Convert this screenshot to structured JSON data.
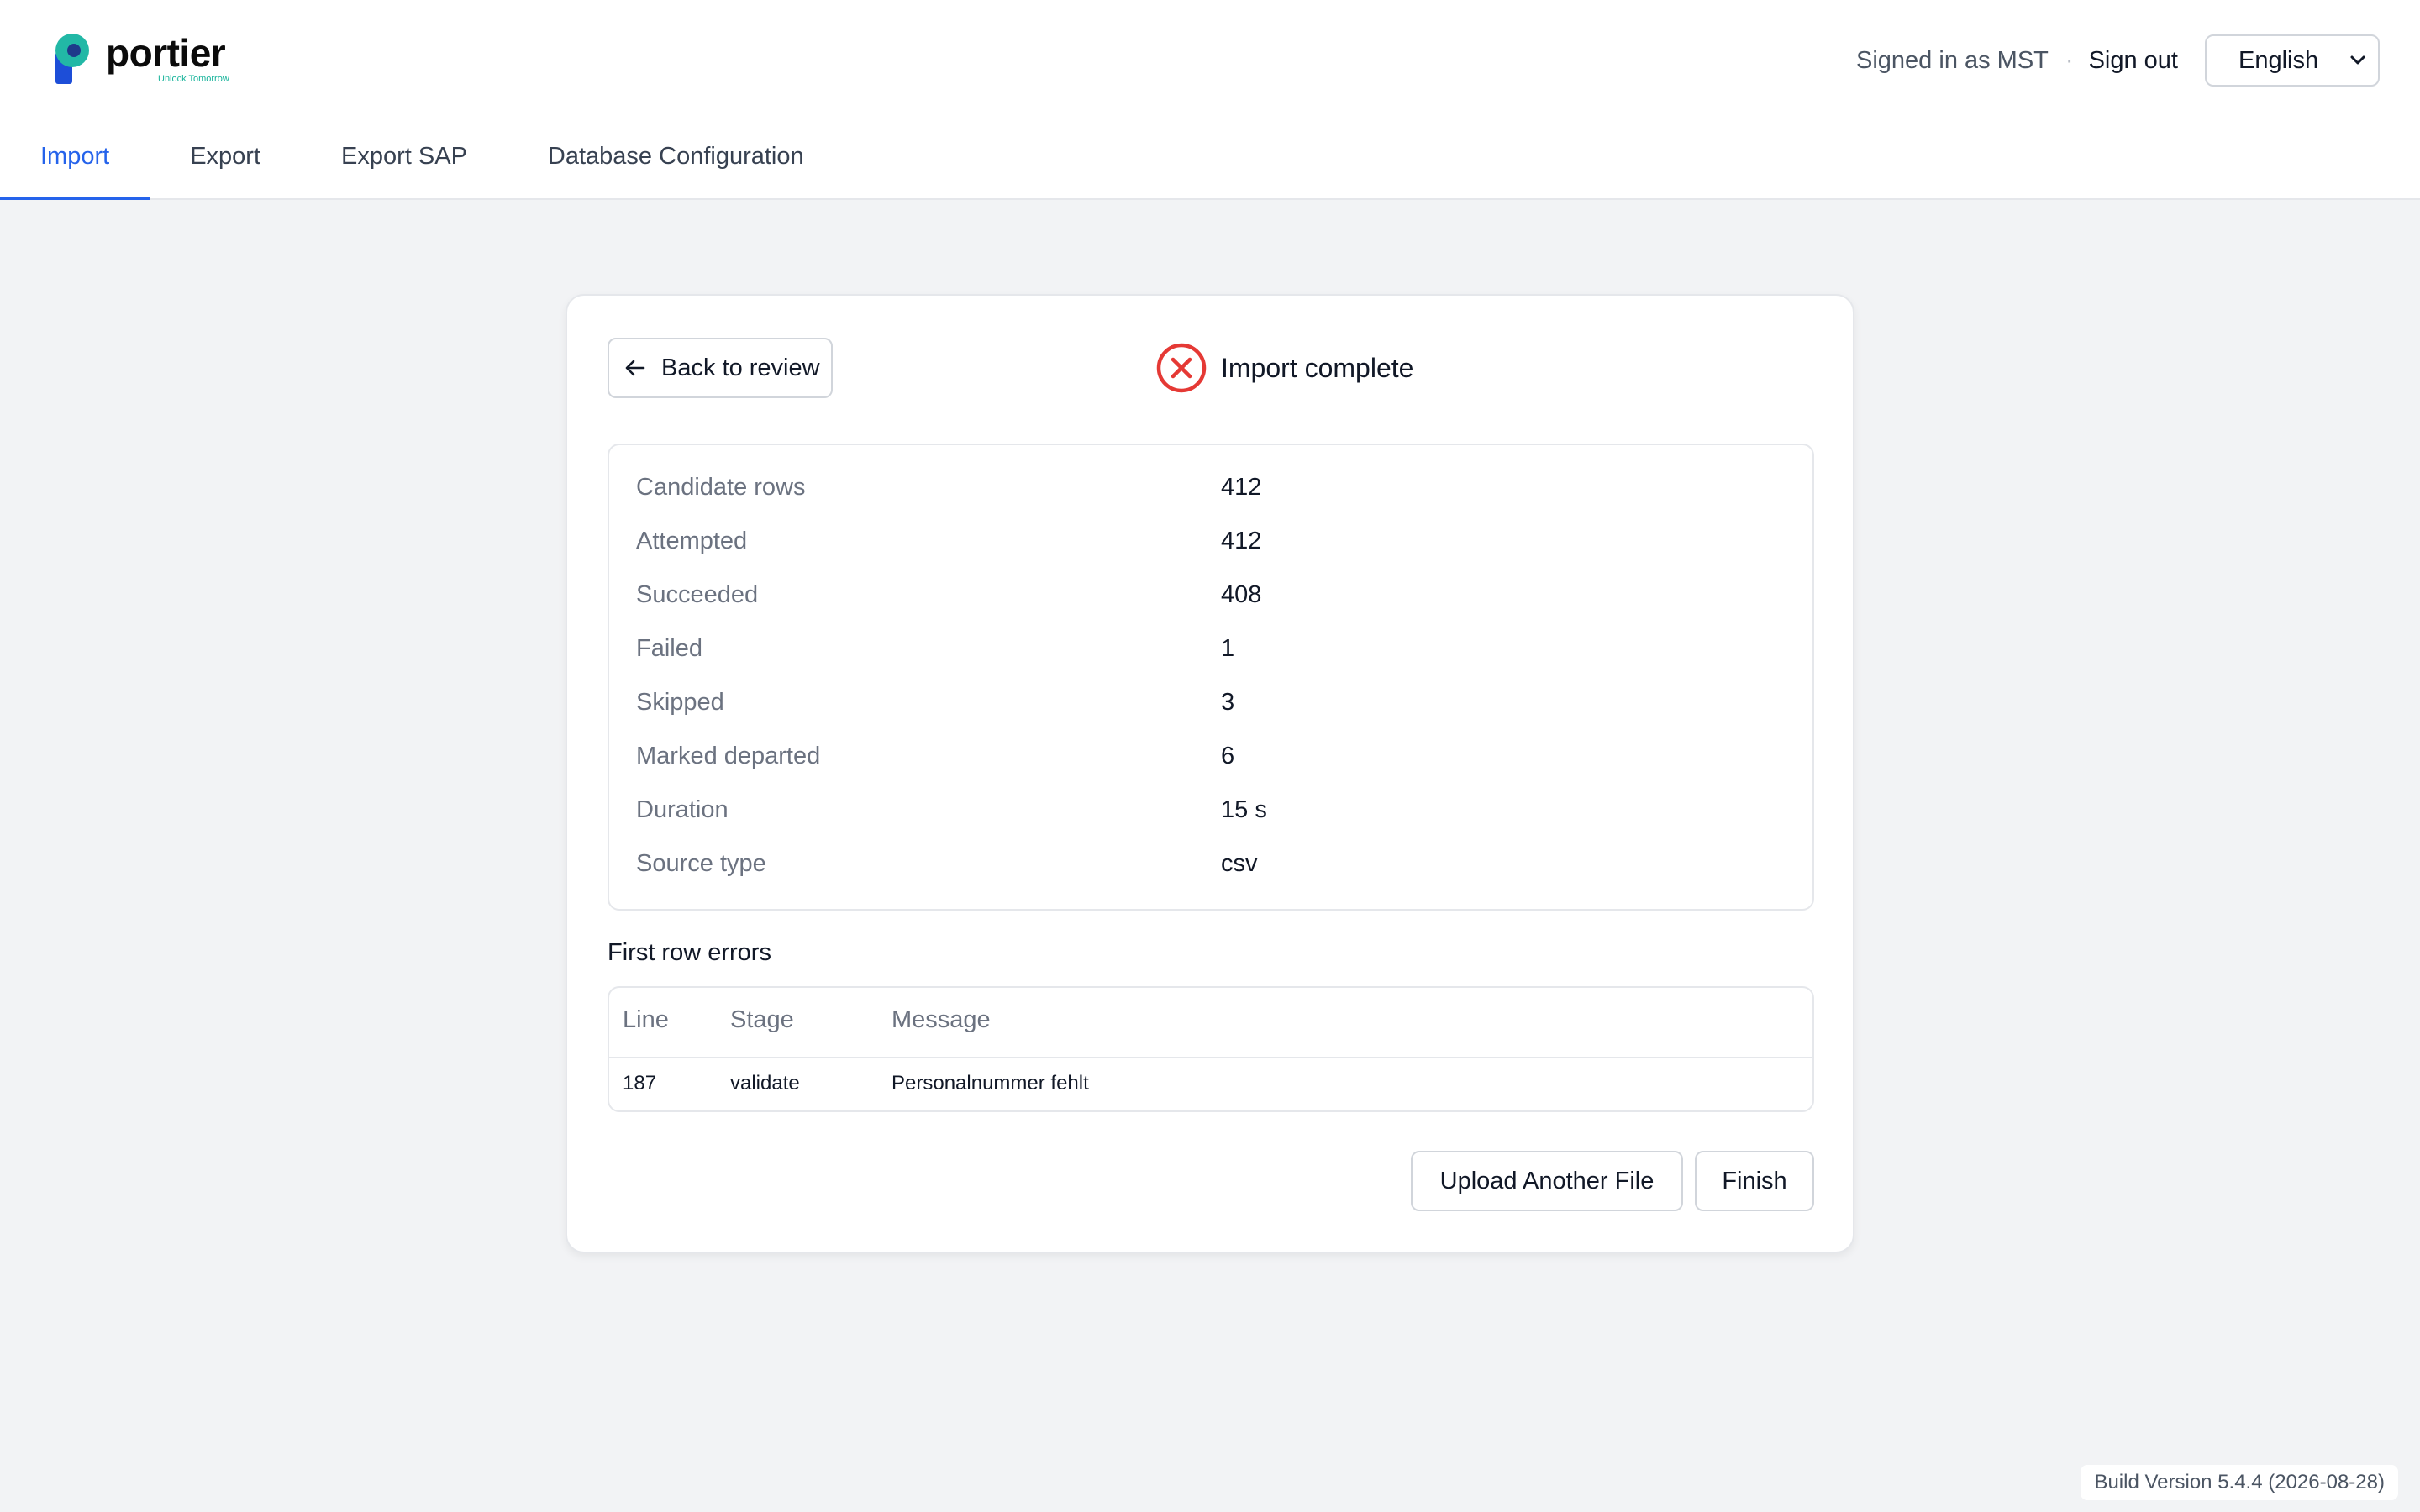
{
  "brand": {
    "name": "portier",
    "tagline": "Unlock Tomorrow",
    "accent": "#16b39a",
    "accent_dark": "#1d4ed8"
  },
  "header": {
    "signed_in": "Signed in as MST",
    "separator": "·",
    "sign_out": "Sign out",
    "language": "English"
  },
  "tabs": [
    {
      "label": "Import",
      "active": true
    },
    {
      "label": "Export",
      "active": false
    },
    {
      "label": "Export SAP",
      "active": false
    },
    {
      "label": "Database Configuration",
      "active": false
    }
  ],
  "card": {
    "back_label": "Back to review",
    "status_title": "Import complete",
    "status_color": "#e53935",
    "stats": [
      {
        "label": "Candidate rows",
        "value": "412"
      },
      {
        "label": "Attempted",
        "value": "412"
      },
      {
        "label": "Succeeded",
        "value": "408"
      },
      {
        "label": "Failed",
        "value": "1"
      },
      {
        "label": "Skipped",
        "value": "3"
      },
      {
        "label": "Marked departed",
        "value": "6"
      },
      {
        "label": "Duration",
        "value": "15 s"
      },
      {
        "label": "Source type",
        "value": "csv"
      }
    ],
    "errors_heading": "First row errors",
    "errors": {
      "columns": [
        "Line",
        "Stage",
        "Message"
      ],
      "rows": [
        {
          "line": "187",
          "stage": "validate",
          "message": "Personalnummer fehlt"
        }
      ]
    },
    "upload_label": "Upload Another File",
    "finish_label": "Finish"
  },
  "build_version": "Build Version 5.4.4 (2026-08-28)"
}
